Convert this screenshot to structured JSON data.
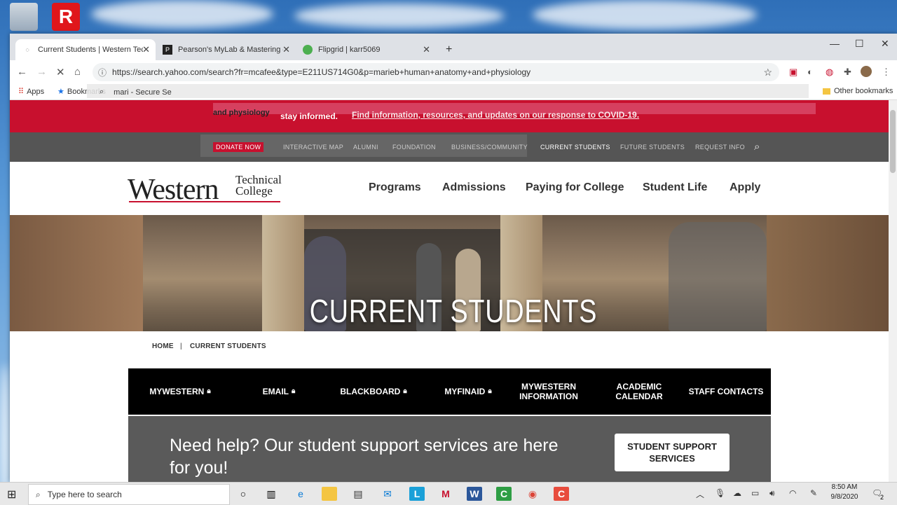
{
  "browser": {
    "tabs": [
      {
        "title": "Current Students | Western Techn",
        "active": true
      },
      {
        "title": "Pearson's MyLab & Mastering – A",
        "active": false
      },
      {
        "title": "Flipgrid | karr5069",
        "active": false
      }
    ],
    "new_tab": "+",
    "url": "https://search.yahoo.com/search?fr=mcafee&type=E211US714G0&p=marieb+human+anatomy+and+physiology",
    "autocomplete_text": "mari - Secure Se",
    "bookmarks": {
      "apps": "Apps",
      "bookmarks": "Bookmarks",
      "other": "Other bookmarks"
    }
  },
  "site": {
    "alert_prefix": "and physiology",
    "alert_stay": "stay informed.",
    "alert_link": "Find information, resources, and updates on our response to COVID-19.",
    "utility_nav": [
      "DONATE NOW",
      "INTERACTIVE MAP",
      "ALUMNI",
      "FOUNDATION",
      "BUSINESS/COMMUNITY",
      "CURRENT STUDENTS",
      "FUTURE STUDENTS",
      "REQUEST INFO"
    ],
    "logo": {
      "western": "Western",
      "technical": "Technical",
      "college": "College"
    },
    "main_nav": [
      "Programs",
      "Admissions",
      "Paying for College",
      "Student Life",
      "Apply"
    ],
    "hero_title": "CURRENT STUDENTS",
    "breadcrumb": {
      "home": "HOME",
      "sep": "|",
      "current": "CURRENT STUDENTS"
    },
    "quick_links": [
      {
        "label": "MYWESTERN",
        "locked": true
      },
      {
        "label": "EMAIL",
        "locked": true
      },
      {
        "label": "BLACKBOARD",
        "locked": true
      },
      {
        "label": "MYFINAID",
        "locked": true
      },
      {
        "label": "MYWESTERN INFORMATION",
        "locked": false
      },
      {
        "label": "ACADEMIC CALENDAR",
        "locked": false
      },
      {
        "label": "STAFF CONTACTS",
        "locked": false
      }
    ],
    "help_text": "Need help? Our student support services are here for you!",
    "help_button": "STUDENT SUPPORT SERVICES"
  },
  "taskbar": {
    "search_placeholder": "Type here to search",
    "time": "8:50 AM",
    "date": "9/8/2020",
    "notification_count": "2"
  },
  "colors": {
    "brand_red": "#c8102e",
    "utility_gray": "#555555",
    "quick_bar": "#000000"
  }
}
